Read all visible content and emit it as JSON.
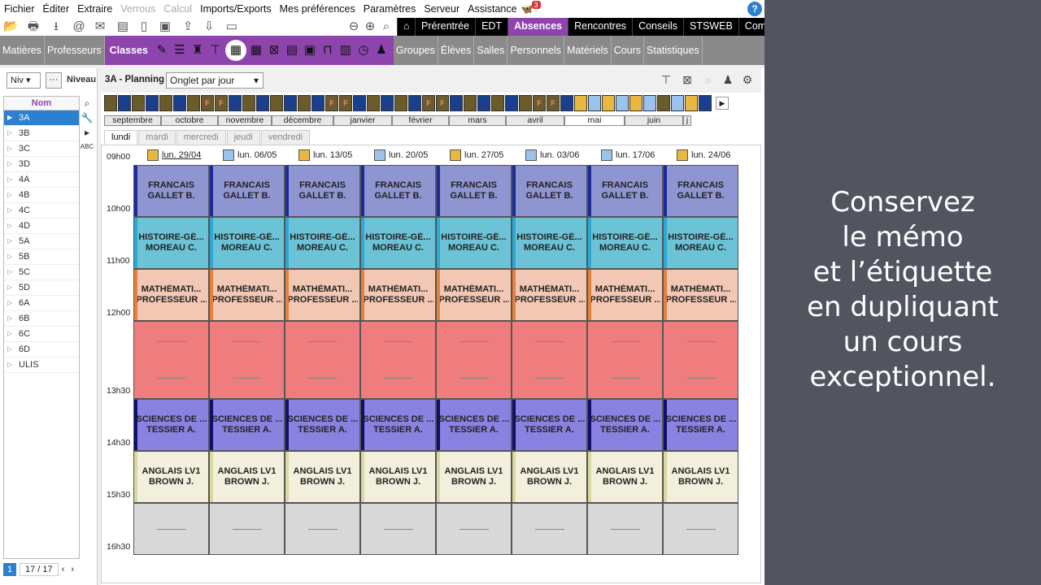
{
  "menubar": {
    "items": [
      "Fichier",
      "Éditer",
      "Extraire",
      "Verrous",
      "Calcul",
      "Imports/Exports",
      "Mes préférences",
      "Paramètres",
      "Serveur",
      "Assistance"
    ],
    "disabled": [
      "Verrous",
      "Calcul"
    ],
    "badge": "3",
    "help": "?"
  },
  "main_tabs": [
    "Prérentrée",
    "EDT",
    "Absences",
    "Rencontres",
    "Conseils",
    "STSWEB",
    "Com"
  ],
  "active_main_tab": "Absences",
  "subnav": {
    "left": [
      "Matières",
      "Professeurs"
    ],
    "active": "Classes",
    "right": [
      "Groupes",
      "Élèves",
      "Salles",
      "Personnels",
      "Matériels",
      "Cours",
      "Statistiques"
    ]
  },
  "left_panel": {
    "filter_value": "Niv",
    "dots": "···",
    "niveau_label": "Niveau",
    "column_header": "Nom",
    "classes": [
      "3A",
      "3B",
      "3C",
      "3D",
      "4A",
      "4B",
      "4C",
      "4D",
      "5A",
      "5B",
      "5C",
      "5D",
      "6A",
      "6B",
      "6C",
      "6D",
      "ULIS"
    ],
    "selected": "3A",
    "pager_current": "1",
    "pager_total": "17 / 17"
  },
  "planning": {
    "title": "3A - Planning",
    "view_select": "Onglet par jour",
    "year_cells": [
      {
        "c": "#6b5a2a",
        "t": ""
      },
      {
        "c": "#1a3f8c",
        "t": ""
      },
      {
        "c": "#6b5a2a",
        "t": ""
      },
      {
        "c": "#1a3f8c",
        "t": ""
      },
      {
        "c": "#6b5a2a",
        "t": ""
      },
      {
        "c": "#1a3f8c",
        "t": ""
      },
      {
        "c": "#6b5a2a",
        "t": ""
      },
      {
        "c": "#6b5a2a",
        "t": "F"
      },
      {
        "c": "#6b5a2a",
        "t": "F"
      },
      {
        "c": "#1a3f8c",
        "t": ""
      },
      {
        "c": "#6b5a2a",
        "t": ""
      },
      {
        "c": "#1a3f8c",
        "t": ""
      },
      {
        "c": "#6b5a2a",
        "t": ""
      },
      {
        "c": "#1a3f8c",
        "t": ""
      },
      {
        "c": "#6b5a2a",
        "t": ""
      },
      {
        "c": "#1a3f8c",
        "t": ""
      },
      {
        "c": "#6b5a2a",
        "t": "F"
      },
      {
        "c": "#6b5a2a",
        "t": "F"
      },
      {
        "c": "#1a3f8c",
        "t": ""
      },
      {
        "c": "#6b5a2a",
        "t": ""
      },
      {
        "c": "#1a3f8c",
        "t": ""
      },
      {
        "c": "#6b5a2a",
        "t": ""
      },
      {
        "c": "#1a3f8c",
        "t": ""
      },
      {
        "c": "#6b5a2a",
        "t": "F"
      },
      {
        "c": "#6b5a2a",
        "t": "F"
      },
      {
        "c": "#1a3f8c",
        "t": ""
      },
      {
        "c": "#6b5a2a",
        "t": ""
      },
      {
        "c": "#1a3f8c",
        "t": ""
      },
      {
        "c": "#6b5a2a",
        "t": ""
      },
      {
        "c": "#1a3f8c",
        "t": ""
      },
      {
        "c": "#6b5a2a",
        "t": ""
      },
      {
        "c": "#6b5a2a",
        "t": "F"
      },
      {
        "c": "#6b5a2a",
        "t": "F"
      },
      {
        "c": "#1a3f8c",
        "t": ""
      },
      {
        "c": "#e8b840",
        "t": ""
      },
      {
        "c": "#9cc3ee",
        "t": ""
      },
      {
        "c": "#e8b840",
        "t": ""
      },
      {
        "c": "#9cc3ee",
        "t": ""
      },
      {
        "c": "#e8b840",
        "t": ""
      },
      {
        "c": "#9cc3ee",
        "t": ""
      },
      {
        "c": "#6b5a2a",
        "t": ""
      },
      {
        "c": "#9cc3ee",
        "t": ""
      },
      {
        "c": "#e8b840",
        "t": ""
      },
      {
        "c": "#1a3f8c",
        "t": ""
      }
    ],
    "months": [
      "septembre",
      "octobre",
      "novembre",
      "décembre",
      "janvier",
      "février",
      "mars",
      "avril",
      "mai",
      "juin",
      "j"
    ],
    "current_month": "mai",
    "day_tabs": [
      "lundi",
      "mardi",
      "mercredi",
      "jeudi",
      "vendredi"
    ],
    "active_day": "lundi",
    "weeks": [
      {
        "label": "lun. 29/04",
        "color": "#e8b840"
      },
      {
        "label": "lun. 06/05",
        "color": "#9cc3ee"
      },
      {
        "label": "lun. 13/05",
        "color": "#e8b840"
      },
      {
        "label": "lun. 20/05",
        "color": "#9cc3ee"
      },
      {
        "label": "lun. 27/05",
        "color": "#e8b840"
      },
      {
        "label": "lun. 03/06",
        "color": "#9cc3ee"
      },
      {
        "label": "lun. 17/06",
        "color": "#9cc3ee"
      },
      {
        "label": "lun. 24/06",
        "color": "#e8b840"
      }
    ],
    "times": [
      "09h00",
      "10h00",
      "11h00",
      "12h00",
      "13h30",
      "14h30",
      "15h30",
      "16h30"
    ],
    "courses": [
      {
        "l1": "FRANCAIS",
        "l2": "GALLET B.",
        "bg": "#8e95d0",
        "band": "#1c2a9c"
      },
      {
        "l1": "HISTOIRE-GÉ...",
        "l2": "MOREAU C.",
        "bg": "#6cc3d6",
        "band": "#2aa9d6"
      },
      {
        "l1": "MATHÉMATI...",
        "l2": "PROFESSEUR ...",
        "bg": "#f2c8b4",
        "band": "#e8803a"
      },
      {
        "l1": "",
        "l2": "",
        "bg": "#f07d7d",
        "band": "#f07d7d"
      },
      {
        "l1": "SCIENCES DE ...",
        "l2": "TESSIER A.",
        "bg": "#8a82e0",
        "band": "#10106a"
      },
      {
        "l1": "ANGLAIS LV1",
        "l2": "BROWN J.",
        "bg": "#f2f0dc",
        "band": "#d8d8a0"
      },
      {
        "l1": "",
        "l2": "",
        "bg": "#d8d8d8",
        "band": "#d8d8d8"
      }
    ]
  },
  "side_note": "Conservez\nle mémo\net l’étiquette\nen dupliquant\nun cours\nexceptionnel."
}
